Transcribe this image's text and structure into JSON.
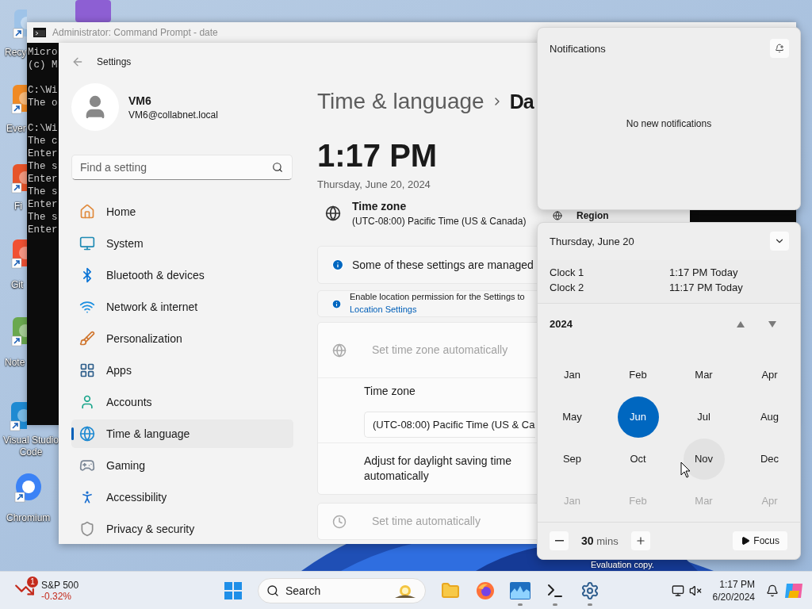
{
  "desktop": {
    "icons": [
      {
        "label": "Recy"
      },
      {
        "label": "Ever"
      },
      {
        "label": "Fi"
      },
      {
        "label": "Git"
      },
      {
        "label": "Note"
      },
      {
        "label": "Visual Studio Code"
      },
      {
        "label": "Chromium"
      }
    ],
    "build_text": "Evaluation copy."
  },
  "console": {
    "title": "Administrator: Command Prompt - date",
    "blocks": [
      [
        "Micro",
        "(c) M"
      ],
      [
        "C:\\Wi",
        "The o"
      ],
      [
        "C:\\Wi",
        "The c",
        "Enter",
        "The s",
        "Enter",
        "The s",
        "Enter",
        "The s",
        "Enter"
      ]
    ]
  },
  "settings": {
    "app_title": "Settings",
    "user": {
      "name": "VM6",
      "email": "VM6@collabnet.local"
    },
    "search": {
      "placeholder": "Find a setting"
    },
    "nav": [
      {
        "label": "Home",
        "selected": false
      },
      {
        "label": "System",
        "selected": false
      },
      {
        "label": "Bluetooth & devices",
        "selected": false
      },
      {
        "label": "Network & internet",
        "selected": false
      },
      {
        "label": "Personalization",
        "selected": false
      },
      {
        "label": "Apps",
        "selected": false
      },
      {
        "label": "Accounts",
        "selected": false
      },
      {
        "label": "Time & language",
        "selected": true
      },
      {
        "label": "Gaming",
        "selected": false
      },
      {
        "label": "Accessibility",
        "selected": false
      },
      {
        "label": "Privacy & security",
        "selected": false
      }
    ],
    "breadcrumb": [
      "Time & language",
      "Da"
    ],
    "clock": {
      "time": "1:17 PM",
      "date": "Thursday, June 20, 2024"
    },
    "time_zone_summary": {
      "label": "Time zone",
      "value": "(UTC-08:00) Pacific Time (US & Canada)"
    },
    "notices": [
      {
        "text": "Some of these settings are managed"
      },
      {
        "text": "Enable location permission for the Settings to",
        "link": "Location Settings"
      }
    ],
    "cards": [
      {
        "rows": [
          {
            "kind": "icon",
            "label": "Set time zone automatically",
            "disabled": true
          },
          {
            "kind": "dropdown",
            "label": "Time zone",
            "value": "(UTC-08:00) Pacific Time (US & Ca",
            "disabled": false
          },
          {
            "kind": "text",
            "label": "Adjust for daylight saving time automatically",
            "disabled": false
          }
        ]
      },
      {
        "rows": [
          {
            "kind": "icon",
            "label": "Set time automatically",
            "disabled": true
          }
        ]
      }
    ],
    "region_row": {
      "label": "Region"
    }
  },
  "notifications": {
    "title": "Notifications",
    "empty_text": "No new notifications"
  },
  "calendar": {
    "date_heading": "Thursday, June 20",
    "clocks": [
      {
        "name": "Clock 1",
        "time": "1:17 PM Today"
      },
      {
        "name": "Clock 2",
        "time": "11:17 PM Today"
      }
    ],
    "year": "2024",
    "months": [
      {
        "label": "Jan",
        "selected": false,
        "hovered": false,
        "next_year": false
      },
      {
        "label": "Feb",
        "selected": false,
        "hovered": false,
        "next_year": false
      },
      {
        "label": "Mar",
        "selected": false,
        "hovered": false,
        "next_year": false
      },
      {
        "label": "Apr",
        "selected": false,
        "hovered": false,
        "next_year": false
      },
      {
        "label": "May",
        "selected": false,
        "hovered": false,
        "next_year": false
      },
      {
        "label": "Jun",
        "selected": true,
        "hovered": false,
        "next_year": false
      },
      {
        "label": "Jul",
        "selected": false,
        "hovered": false,
        "next_year": false
      },
      {
        "label": "Aug",
        "selected": false,
        "hovered": false,
        "next_year": false
      },
      {
        "label": "Sep",
        "selected": false,
        "hovered": false,
        "next_year": false
      },
      {
        "label": "Oct",
        "selected": false,
        "hovered": false,
        "next_year": false
      },
      {
        "label": "Nov",
        "selected": false,
        "hovered": true,
        "next_year": false
      },
      {
        "label": "Dec",
        "selected": false,
        "hovered": false,
        "next_year": false
      },
      {
        "label": "Jan",
        "selected": false,
        "hovered": false,
        "next_year": true
      },
      {
        "label": "Feb",
        "selected": false,
        "hovered": false,
        "next_year": true
      },
      {
        "label": "Mar",
        "selected": false,
        "hovered": false,
        "next_year": true
      },
      {
        "label": "Apr",
        "selected": false,
        "hovered": false,
        "next_year": true
      }
    ],
    "focus": {
      "minutes": "30",
      "unit": "mins",
      "button": "Focus"
    }
  },
  "taskbar": {
    "widget": {
      "badge": "1",
      "name": "S&P 500",
      "change": "-0.32%"
    },
    "search_label": "Search",
    "apps": [
      {
        "running": false
      },
      {
        "running": false
      },
      {
        "running": true
      },
      {
        "running": true
      },
      {
        "running": true
      }
    ],
    "clock": {
      "time": "1:17 PM",
      "date": "6/20/2024"
    }
  }
}
